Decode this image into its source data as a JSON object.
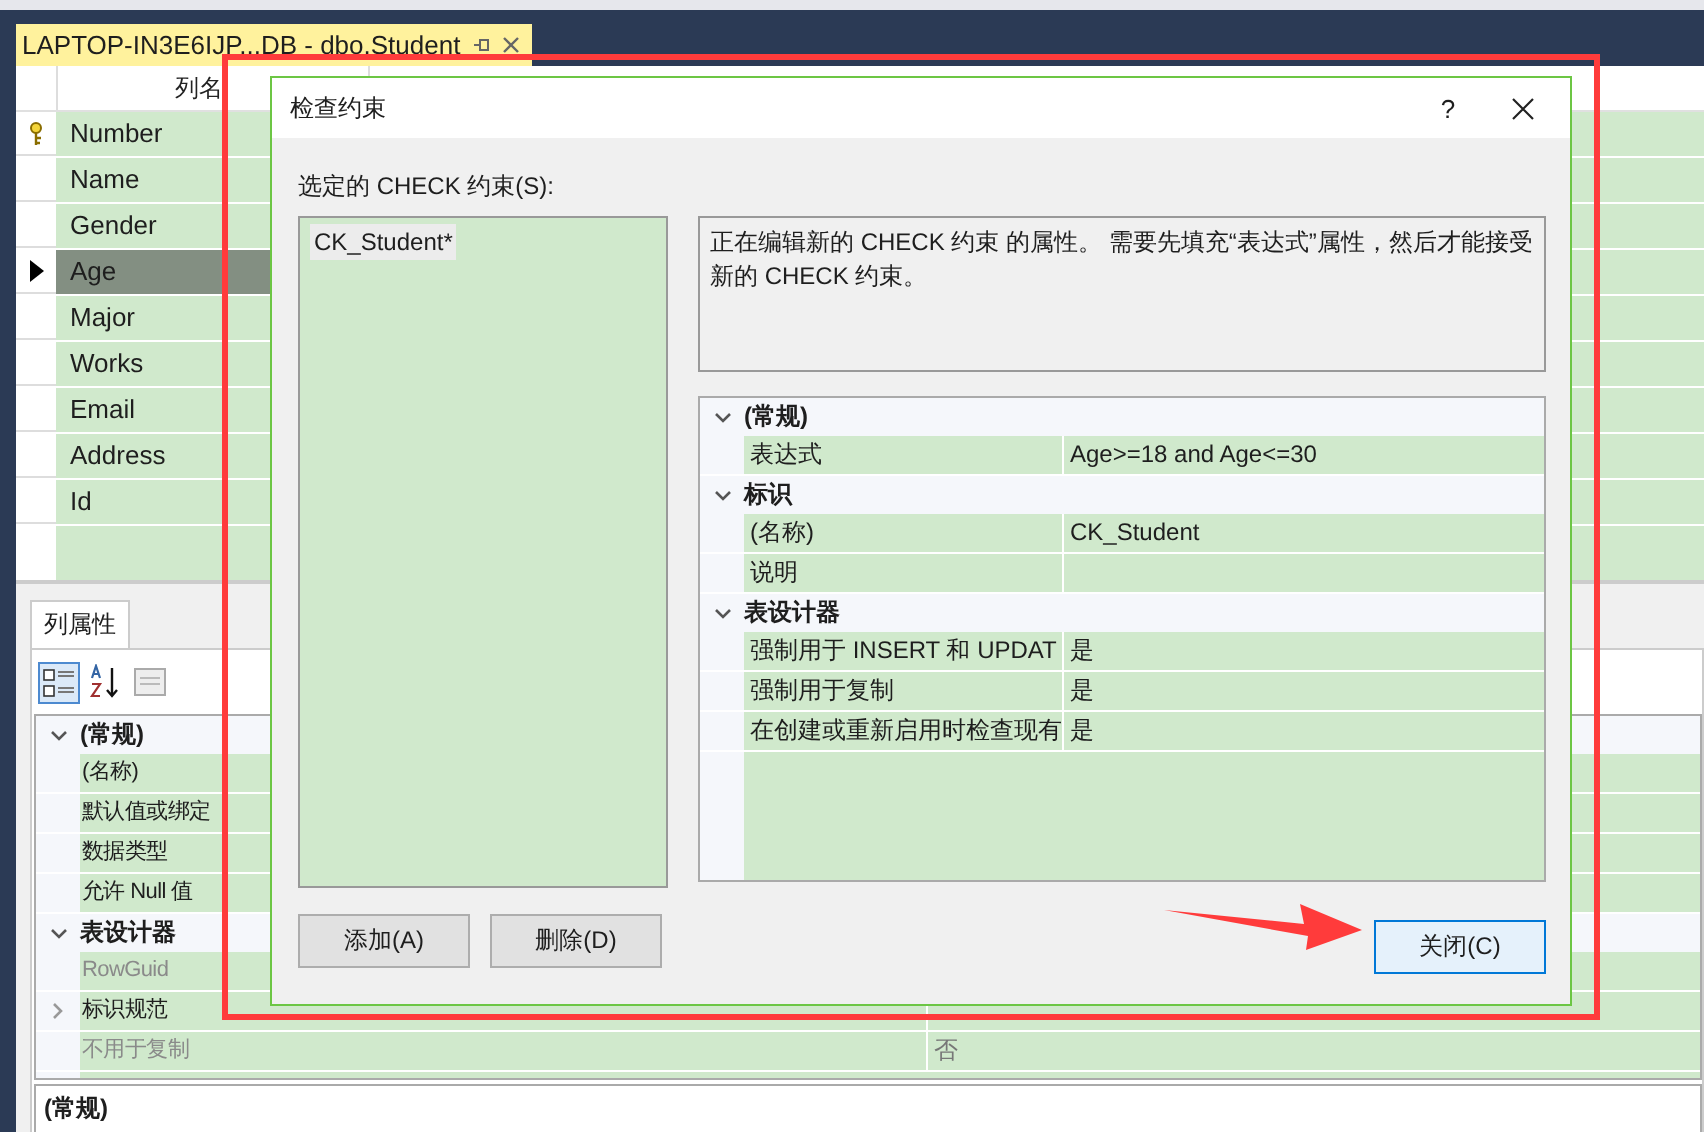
{
  "designer_tab": {
    "title": "LAPTOP-IN3E6IJP...DB - dbo.Student"
  },
  "columns_grid": {
    "header": "列名",
    "rows": [
      {
        "name": "Number",
        "primary_key": true,
        "selected": false
      },
      {
        "name": "Name",
        "primary_key": false,
        "selected": false
      },
      {
        "name": "Gender",
        "primary_key": false,
        "selected": false
      },
      {
        "name": "Age",
        "primary_key": false,
        "selected": true
      },
      {
        "name": "Major",
        "primary_key": false,
        "selected": false
      },
      {
        "name": "Works",
        "primary_key": false,
        "selected": false
      },
      {
        "name": "Email",
        "primary_key": false,
        "selected": false
      },
      {
        "name": "Address",
        "primary_key": false,
        "selected": false
      },
      {
        "name": "Id",
        "primary_key": false,
        "selected": false
      }
    ]
  },
  "column_properties": {
    "tab": "列属性",
    "groups": [
      {
        "title": "(常规)",
        "expanded": true,
        "rows": [
          {
            "name": "(名称)",
            "disabled": false
          },
          {
            "name": "默认值或绑定",
            "disabled": false
          },
          {
            "name": "数据类型",
            "disabled": false
          },
          {
            "name": "允许 Null 值",
            "disabled": false
          }
        ]
      },
      {
        "title": "表设计器",
        "expanded": true,
        "rows": [
          {
            "name": "RowGuid",
            "disabled": true
          },
          {
            "name": "标识规范",
            "disabled": false,
            "expandable": true
          },
          {
            "name": "不用于复制",
            "disabled": true,
            "value": "否"
          }
        ]
      }
    ],
    "description_title": "(常规)"
  },
  "dialog": {
    "title": "检查约束",
    "help": "?",
    "list_label": "选定的 CHECK 约束(S):",
    "constraints": [
      {
        "name": "CK_Student*",
        "selected": true
      }
    ],
    "description": "正在编辑新的 CHECK 约束 的属性。 需要先填充“表达式”属性，然后才能接受新的 CHECK 约束。",
    "properties": [
      {
        "title": "(常规)",
        "expanded": true,
        "rows": [
          {
            "name": "表达式",
            "value": "Age>=18 and Age<=30"
          }
        ]
      },
      {
        "title": "标识",
        "expanded": true,
        "rows": [
          {
            "name": "(名称)",
            "value": "CK_Student"
          },
          {
            "name": "说明"
          }
        ]
      },
      {
        "title": "表设计器",
        "expanded": true,
        "rows": [
          {
            "name": "强制用于 INSERT 和 UPDAT",
            "value": "是"
          },
          {
            "name": "强制用于复制",
            "value": "是"
          },
          {
            "name": "在创建或重新启用时检查现有",
            "value": "是"
          }
        ]
      }
    ],
    "buttons": [
      {
        "kind": "add",
        "label": "添加(A)"
      },
      {
        "kind": "delete",
        "label": "删除(D)"
      },
      {
        "kind": "close",
        "label": "关闭(C)",
        "default": true
      }
    ]
  }
}
